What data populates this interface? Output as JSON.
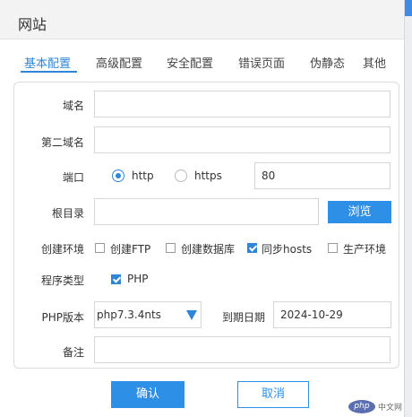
{
  "window": {
    "title": "网站"
  },
  "tabs": [
    {
      "label": "基本配置",
      "active": true
    },
    {
      "label": "高级配置"
    },
    {
      "label": "安全配置"
    },
    {
      "label": "错误页面"
    },
    {
      "label": "伪静态"
    },
    {
      "label": "其他"
    }
  ],
  "form": {
    "domain": {
      "label": "域名",
      "value": ""
    },
    "second_domain": {
      "label": "第二域名",
      "value": ""
    },
    "port": {
      "label": "端口",
      "options": [
        {
          "label": "http",
          "selected": true
        },
        {
          "label": "https",
          "selected": false
        }
      ],
      "value": "80"
    },
    "root_dir": {
      "label": "根目录",
      "value": "",
      "browse_label": "浏览"
    },
    "create_env": {
      "label": "创建环境",
      "options": [
        {
          "label": "创建FTP",
          "checked": false
        },
        {
          "label": "创建数据库",
          "checked": false
        },
        {
          "label": "同步hosts",
          "checked": true
        },
        {
          "label": "生产环境",
          "checked": false
        }
      ]
    },
    "program_type": {
      "label": "程序类型",
      "options": [
        {
          "label": "PHP",
          "checked": true
        }
      ]
    },
    "php_version": {
      "label": "PHP版本",
      "value": "php7.3.4nts"
    },
    "expire_date": {
      "label": "到期日期",
      "value": "2024-10-29"
    },
    "remark": {
      "label": "备注",
      "value": ""
    }
  },
  "buttons": {
    "confirm": "确认",
    "cancel": "取消"
  },
  "watermark": {
    "logo": "php",
    "text": "中文网"
  },
  "colors": {
    "accent": "#2e8fe6",
    "tab_active": "#2f86d6"
  }
}
